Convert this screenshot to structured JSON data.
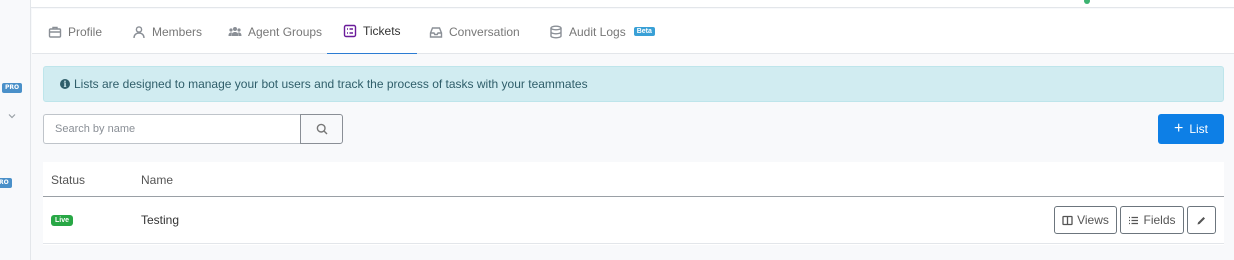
{
  "tabs": [
    {
      "label": "Profile",
      "icon": "briefcase-icon"
    },
    {
      "label": "Members",
      "icon": "user-icon"
    },
    {
      "label": "Agent Groups",
      "icon": "users-icon"
    },
    {
      "label": "Tickets",
      "icon": "ticket-list-icon",
      "active": true
    },
    {
      "label": "Conversation",
      "icon": "inbox-icon"
    },
    {
      "label": "Audit Logs",
      "icon": "database-icon",
      "badge": "Beta"
    }
  ],
  "sidebar": {
    "badges": [
      "PRO",
      "RO"
    ]
  },
  "alert": {
    "text": "Lists are designed to manage your bot users and track the process of tasks with your teammates"
  },
  "search": {
    "placeholder": "Search by name"
  },
  "add_button": {
    "label": "List"
  },
  "table": {
    "columns": [
      "Status",
      "Name"
    ],
    "rows": [
      {
        "status": "Live",
        "name": "Testing",
        "actions": [
          "Views",
          "Fields"
        ]
      }
    ]
  },
  "colors": {
    "accent": "#0d7fe6",
    "live": "#28a745",
    "alert_bg": "#d1ecf1",
    "beta": "#39a0d6",
    "pro": "#4a90c9"
  }
}
